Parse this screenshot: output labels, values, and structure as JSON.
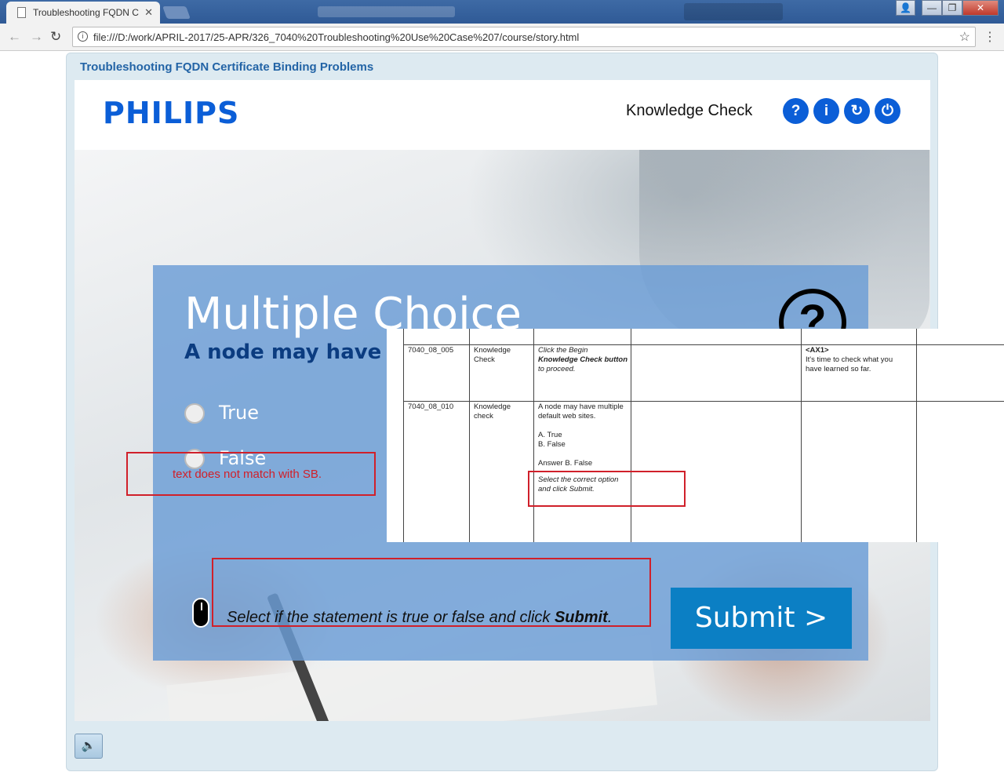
{
  "browser": {
    "tab_title": "Troubleshooting FQDN C",
    "tab_close": "✕",
    "url": "file:///D:/work/APRIL-2017/25-APR/326_7040%20Troubleshooting%20Use%20Case%207/course/story.html",
    "nav_back": "←",
    "nav_forward": "→",
    "nav_reload": "↻",
    "info": "i",
    "star": "☆",
    "menu": "⋮",
    "win_user": "👤",
    "win_min": "—",
    "win_max": "❐",
    "win_close": "✕"
  },
  "course": {
    "title": "Troubleshooting FQDN Certificate Binding Problems",
    "logo": "PHILIPS",
    "section": "Knowledge Check",
    "header_buttons": [
      "?",
      "i",
      "↻",
      "⏻"
    ]
  },
  "quiz": {
    "heading": "Multiple Choice",
    "question": "A node may have multiple default web sites",
    "help_symbol": "?",
    "options": [
      "True",
      "False"
    ],
    "instruction_prefix": "Select if the statement is true or false and click ",
    "instruction_bold": "Submit",
    "instruction_suffix": ".",
    "submit_label": "Submit  >"
  },
  "annotation": {
    "note": "text does not match with SB."
  },
  "storyboard": {
    "rows": [
      {
        "id": "7040_08_005",
        "type": "Knowledge Check",
        "text_lines": [
          "Click the Begin",
          "Knowledge Check button",
          "to proceed."
        ],
        "audio_tag": "<AX1>",
        "audio_lines": [
          "It's time to check what you",
          "have learned so far."
        ]
      },
      {
        "id": "7040_08_010",
        "type": "Knowledge check",
        "text_lines": [
          "A node may have multiple",
          "default web sites.",
          "",
          "A. True",
          "B. False",
          "",
          "Answer B. False"
        ],
        "instruction_lines": [
          "Select the correct option",
          "and click Submit."
        ]
      }
    ]
  },
  "footer": {
    "sound_icon": "🔈"
  }
}
